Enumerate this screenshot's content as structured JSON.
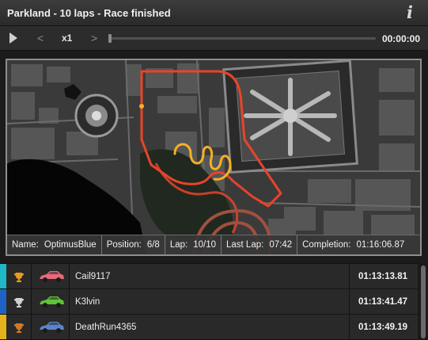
{
  "window": {
    "title": "Parkland - 10 laps - Race finished",
    "info_icon": "info-icon"
  },
  "playback": {
    "play_icon": "play-icon",
    "prev_icon": "chevron-left-icon",
    "next_icon": "chevron-right-icon",
    "prev_glyph": "<",
    "next_glyph": ">",
    "speed": "x1",
    "timeline_progress": 0,
    "time": "00:00:00"
  },
  "map": {
    "route_color": "#e8442a",
    "highlight_color": "#f5b025"
  },
  "status": {
    "name_label": "Name:",
    "name_value": "OptimusBlue",
    "position_label": "Position:",
    "position_value": "6/8",
    "lap_label": "Lap:",
    "lap_value": "10/10",
    "last_lap_label": "Last Lap:",
    "last_lap_value": "07:42",
    "completion_label": "Completion:",
    "completion_value": "01:16:06.87"
  },
  "results": [
    {
      "player": "Cail9117",
      "time": "01:13:13.81",
      "edge_color": "#1fb8c4",
      "trophy": "gold-trophy-icon",
      "trophy_color": "#e59a1c",
      "car": "pink-car-icon",
      "car_color": "#e8697a"
    },
    {
      "player": "K3lvin",
      "time": "01:13:41.47",
      "edge_color": "#1f62c4",
      "trophy": "silver-trophy-icon",
      "trophy_color": "#d0d0d0",
      "car": "green-car-icon",
      "car_color": "#5fc33a"
    },
    {
      "player": "DeathRun4365",
      "time": "01:13:49.19",
      "edge_color": "#e6b21b",
      "trophy": "bronze-trophy-icon",
      "trophy_color": "#d07a22",
      "car": "blue-car-icon",
      "car_color": "#5a84c7"
    }
  ]
}
